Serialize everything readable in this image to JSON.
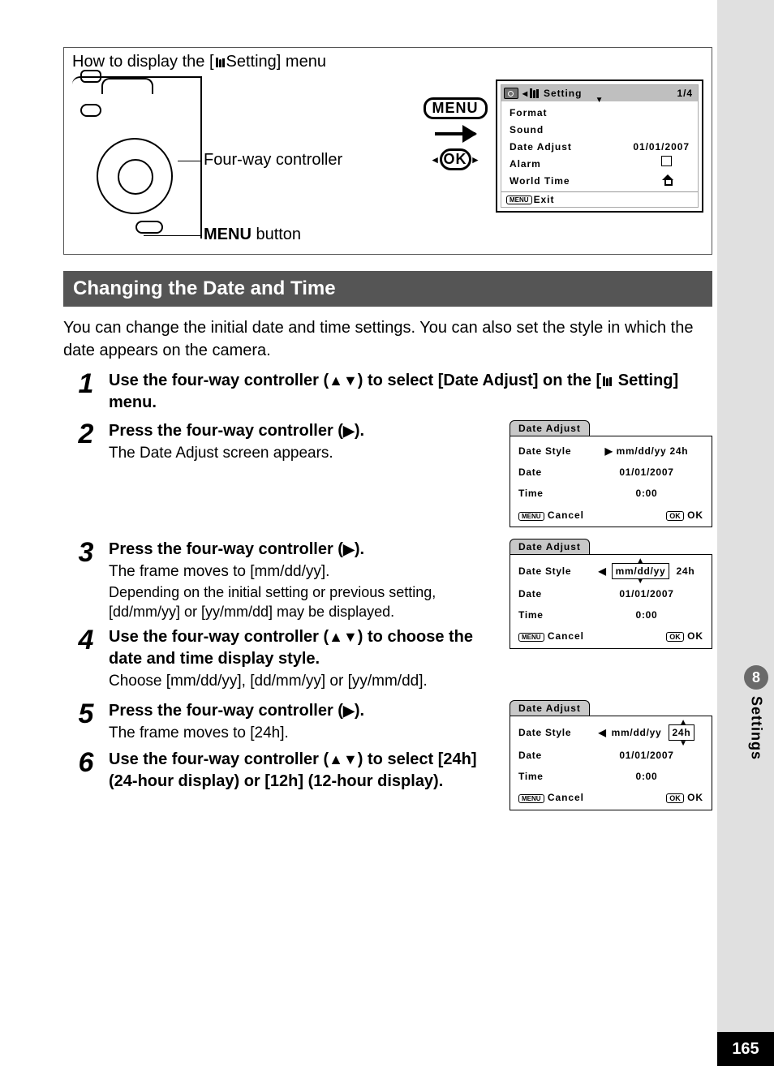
{
  "page": {
    "number": "165"
  },
  "tab": {
    "chapter": "8",
    "label": "Settings"
  },
  "howto": {
    "title_pre": "How to display the [",
    "title_post": " Setting] menu",
    "label_four_way": "Four-way controller",
    "label_menu_bold": "MENU",
    "label_menu_suffix": " button",
    "menu_box": "MENU",
    "ok_box": "OK"
  },
  "lcd_top": {
    "title": "Setting",
    "page": "1/4",
    "items": {
      "format": "Format",
      "sound": "Sound",
      "date_adjust": "Date Adjust",
      "date_adjust_val": "01/01/2007",
      "alarm": "Alarm",
      "world_time": "World Time"
    },
    "exit_menu": "MENU",
    "exit": "Exit"
  },
  "heading": "Changing the Date and Time",
  "intro": "You can change the initial date and time settings. You can also set the style in which the date appears on the camera.",
  "steps": {
    "s1": {
      "num": "1",
      "text_a": "Use the four-way controller (",
      "text_b": ") to select [Date Adjust] on the [",
      "text_c": " Setting] menu."
    },
    "s2": {
      "num": "2",
      "text": "Press the four-way controller (",
      "text_end": ").",
      "desc": "The Date Adjust screen appears."
    },
    "s3": {
      "num": "3",
      "text": "Press the four-way controller (",
      "text_end": ").",
      "desc1": "The frame moves to [mm/dd/yy].",
      "desc2": "Depending on the initial setting or previous setting, [dd/mm/yy] or [yy/mm/dd] may be displayed."
    },
    "s4": {
      "num": "4",
      "text_a": "Use the four-way controller (",
      "text_b": ") to choose the date and time display style.",
      "desc": "Choose [mm/dd/yy], [dd/mm/yy] or [yy/mm/dd]."
    },
    "s5": {
      "num": "5",
      "text": "Press the four-way controller (",
      "text_end": ").",
      "desc": "The frame moves to [24h]."
    },
    "s6": {
      "num": "6",
      "text_a": "Use the four-way controller (",
      "text_b": ") to select [24h] (24-hour display) or [12h] (12-hour display)."
    }
  },
  "lcd_small": {
    "tab": "Date Adjust",
    "date_style": "Date Style",
    "date_style_val": "mm/dd/yy",
    "hour_val": "24h",
    "date": "Date",
    "date_val": "01/01/2007",
    "time": "Time",
    "time_val": "0:00",
    "cancel_menu": "MENU",
    "cancel": "Cancel",
    "ok_btn": "OK",
    "ok": "OK"
  }
}
